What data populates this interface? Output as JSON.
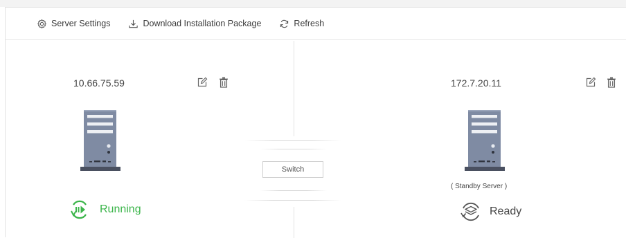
{
  "toolbar": {
    "server_settings": "Server Settings",
    "download": "Download Installation Package",
    "refresh": "Refresh"
  },
  "left_server": {
    "ip": "10.66.75.59",
    "status": "Running",
    "status_color": "#3bb54a"
  },
  "right_server": {
    "ip": "172.7.20.11",
    "role": "( Standby Server )",
    "status": "Ready",
    "status_color": "#444444"
  },
  "switch_label": "Switch",
  "colors": {
    "server_body": "#7f8ba3",
    "server_base": "#4a5060",
    "running_green": "#3bb54a"
  }
}
